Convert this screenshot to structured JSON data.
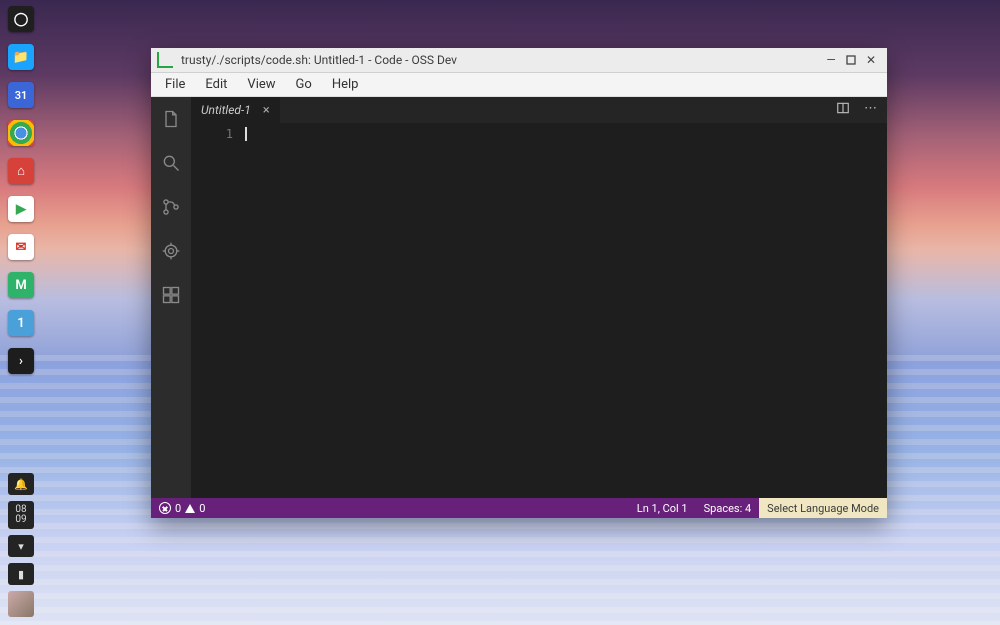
{
  "dock": {
    "items": [
      {
        "name": "launcher",
        "bg": "#1f1f1f",
        "glyph": "◯"
      },
      {
        "name": "files",
        "bg": "#1aa3ff",
        "glyph": "📁"
      },
      {
        "name": "calendar",
        "bg": "#3b66d8",
        "glyph": "31"
      },
      {
        "name": "chrome",
        "bg": "#ffffff",
        "glyph": "◉"
      },
      {
        "name": "app-red",
        "bg": "#d6413a",
        "glyph": "⌂"
      },
      {
        "name": "play-store",
        "bg": "#ffffff",
        "glyph": "▶"
      },
      {
        "name": "gmail",
        "bg": "#ffffff",
        "glyph": "✉"
      },
      {
        "name": "app-m",
        "bg": "#2fb36a",
        "glyph": "M"
      },
      {
        "name": "app-one",
        "bg": "#4aa0d8",
        "glyph": "1"
      },
      {
        "name": "terminal",
        "bg": "#1d1d1d",
        "glyph": "›"
      }
    ]
  },
  "tray": {
    "notifications_glyph": "🔔",
    "date_top": "08",
    "date_bottom": "09",
    "wifi_glyph": "▾",
    "battery_glyph": "▮"
  },
  "window": {
    "title": "trusty/./scripts/code.sh: Untitled-1 - Code - OSS Dev"
  },
  "menu": [
    "File",
    "Edit",
    "View",
    "Go",
    "Help"
  ],
  "activity_icons": [
    "explorer",
    "search",
    "source-control",
    "debug",
    "extensions"
  ],
  "tab": {
    "label": "Untitled-1"
  },
  "gutter": {
    "line": "1"
  },
  "status": {
    "errors": "0",
    "warnings": "0",
    "position": "Ln 1, Col 1",
    "spaces": "Spaces: 4",
    "language": "Select Language Mode"
  }
}
